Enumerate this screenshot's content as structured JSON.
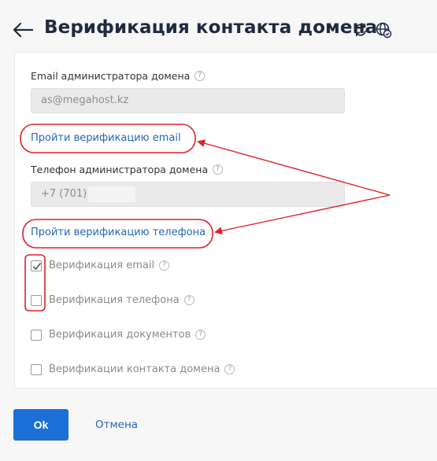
{
  "header": {
    "title": "Верификация контакта домена"
  },
  "form": {
    "email_label": "Email администратора домена",
    "email_value": "as@megahost.kz",
    "verify_email_link": "Пройти верификацию email",
    "phone_label": "Телефон администратора домена",
    "phone_value": "+7 (701)",
    "verify_phone_link": "Пройти верификацию телефона",
    "help_glyph": "?"
  },
  "checks": [
    {
      "label": "Верификация email",
      "checked": true
    },
    {
      "label": "Верификация телефона",
      "checked": false
    },
    {
      "label": "Верификация документов",
      "checked": false
    },
    {
      "label": "Верификации контакта домена",
      "checked": false
    }
  ],
  "footer": {
    "ok_label": "Ok",
    "cancel_label": "Отмена"
  },
  "colors": {
    "accent": "#1c6fd6",
    "link": "#2666b8",
    "annotation": "#e0202a"
  },
  "icons": [
    "back-arrow-icon",
    "refresh-icon",
    "globe-icon",
    "help-icon",
    "checkmark-icon"
  ]
}
